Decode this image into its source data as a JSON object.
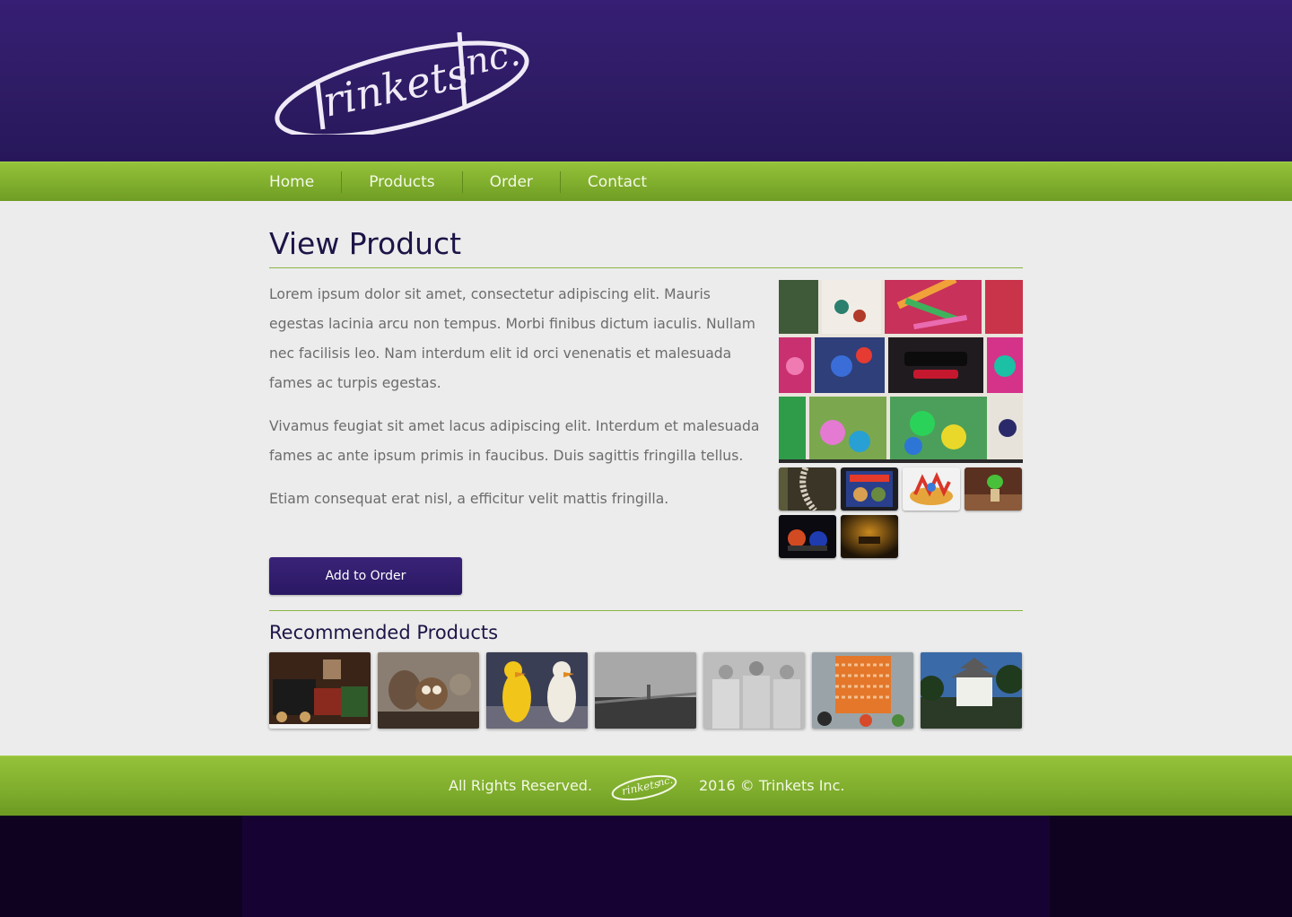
{
  "header": {
    "logo_text": "trinkets Inc."
  },
  "nav": {
    "items": [
      {
        "label": "Home"
      },
      {
        "label": "Products"
      },
      {
        "label": "Order"
      },
      {
        "label": "Contact"
      }
    ]
  },
  "main": {
    "title": "View Product",
    "paragraphs": [
      "Lorem ipsum dolor sit amet, consectetur adipiscing elit. Mauris egestas lacinia arcu non tempus. Morbi finibus dictum iaculis. Nullam nec facilisis leo. Nam interdum elit id orci venenatis et malesuada fames ac turpis egestas.",
      "Vivamus feugiat sit amet lacus adipiscing elit. Interdum et malesuada fames ac ante ipsum primis in faucibus. Duis sagittis fringilla tellus.",
      "Etiam consequat erat nisl, a efficitur velit mattis fringilla."
    ],
    "add_button_label": "Add to Order",
    "recommended_title": "Recommended Products"
  },
  "footer": {
    "left_text": "All Rights Reserved.",
    "right_text": "2016 © Trinkets Inc."
  },
  "colors": {
    "header_purple": "#2f1c66",
    "nav_green": "#7eac2c",
    "title_navy": "#1d1547",
    "body_text": "#6c6c6c",
    "page_bg": "#ececec"
  }
}
